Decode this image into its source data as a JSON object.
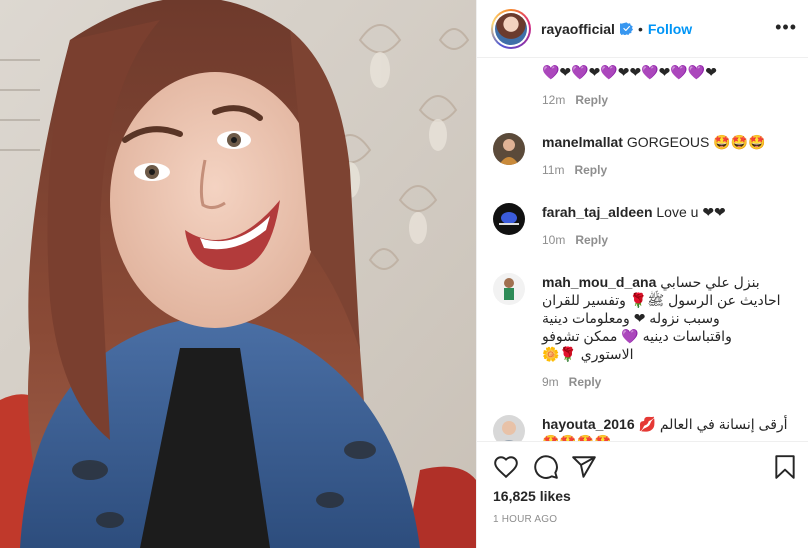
{
  "post": {
    "author": "rayaofficial",
    "follow_label": "Follow",
    "separator": "•",
    "more_label": "•••",
    "photo_alt": "Smiling woman with long auburn hair wearing a denim jacket"
  },
  "comments": [
    {
      "user": "",
      "text": "💜❤💜❤💜❤❤💜❤💜💜❤",
      "time": "12m",
      "reply_label": "Reply"
    },
    {
      "user": "manelmallat",
      "text": "GORGEOUS 🤩🤩🤩",
      "time": "11m",
      "reply_label": "Reply"
    },
    {
      "user": "farah_taj_aldeen",
      "text": "Love u ❤❤",
      "time": "10m",
      "reply_label": "Reply"
    },
    {
      "user": "mah_mou_d_ana",
      "text_lines": [
        "بنزل علي حسابي",
        "احاديث عن الرسول ﷺ🌹 وتفسير للقران",
        "وسبب نزوله ❤ ومعلومات دينية",
        "واقتباسات دينيه 💜 ممكن تشوفو",
        "الاستوري 🌹🌼"
      ],
      "time": "9m",
      "reply_label": "Reply"
    },
    {
      "user": "hayouta_2016",
      "text": "أرقى إنسانة في العالم 💋",
      "extra": "🤩🤩🤩🤩",
      "time": "",
      "reply_label": ""
    }
  ],
  "actions": {
    "like_icon": "heart-icon",
    "comment_icon": "comment-icon",
    "share_icon": "paper-plane-icon",
    "save_icon": "bookmark-icon"
  },
  "likes_label": "16,825 likes",
  "timestamp": "1 HOUR AGO",
  "colors": {
    "accent": "#0095f6",
    "text": "#262626",
    "muted": "#8e8e8e",
    "border": "#efefef"
  }
}
